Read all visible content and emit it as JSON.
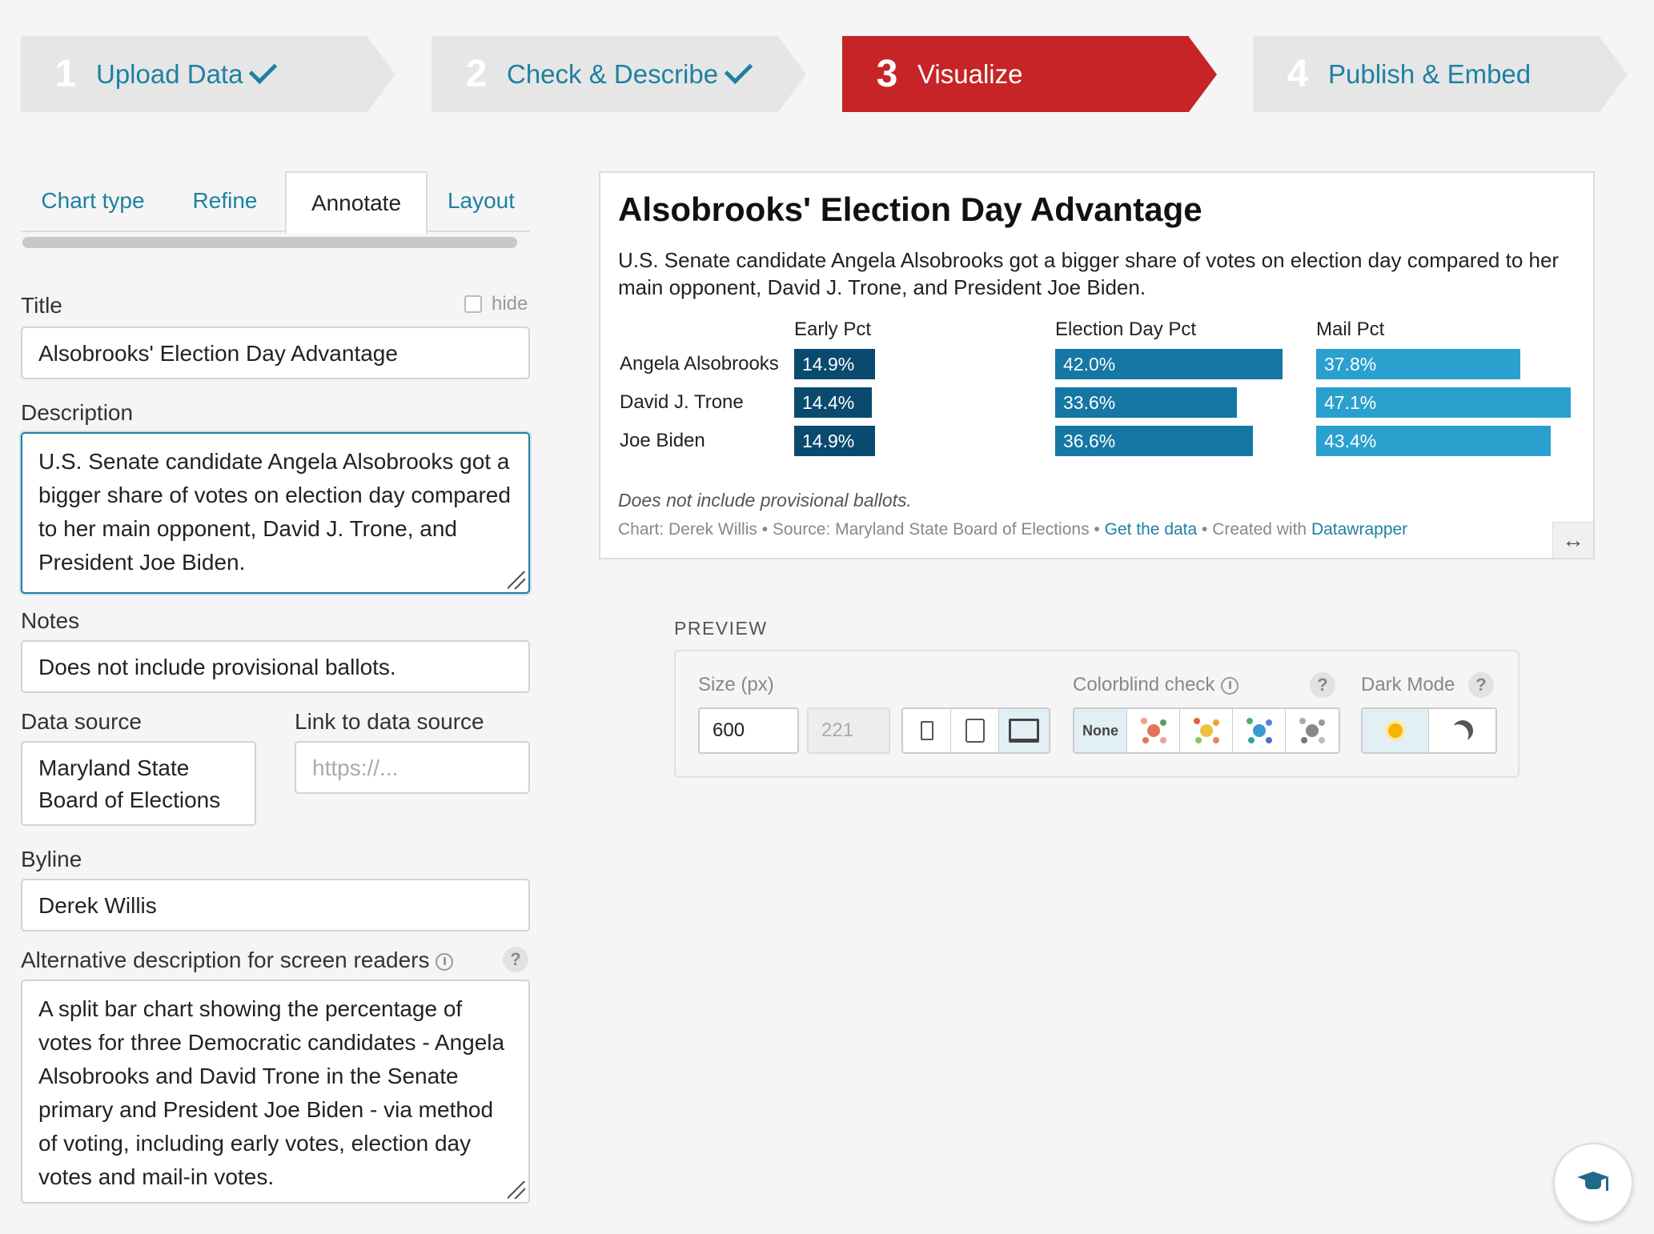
{
  "steps": [
    {
      "num": "1",
      "label": "Upload Data",
      "done": true,
      "active": false
    },
    {
      "num": "2",
      "label": "Check & Describe",
      "done": true,
      "active": false
    },
    {
      "num": "3",
      "label": "Visualize",
      "done": false,
      "active": true
    },
    {
      "num": "4",
      "label": "Publish & Embed",
      "done": false,
      "active": false
    }
  ],
  "tabs": [
    "Chart type",
    "Refine",
    "Annotate",
    "Layout"
  ],
  "active_tab": "Annotate",
  "form": {
    "title_label": "Title",
    "hide_label": "hide",
    "title_value": "Alsobrooks' Election Day Advantage",
    "description_label": "Description",
    "description_value": "U.S. Senate candidate Angela Alsobrooks got a bigger share of votes on election day compared to her main opponent, David J. Trone, and President Joe Biden.",
    "notes_label": "Notes",
    "notes_value": "Does not include provisional ballots.",
    "source_label": "Data source",
    "source_value": "Maryland State Board of Elections",
    "link_label": "Link to data source",
    "link_placeholder": "https://...",
    "byline_label": "Byline",
    "byline_value": "Derek Willis",
    "alt_label": "Alternative description for screen readers",
    "alt_value": "A split bar chart showing the percentage of votes for three Democratic candidates - Angela Alsobrooks and David Trone in the Senate primary and President Joe Biden - via method of voting, including early votes, election day votes and mail-in votes."
  },
  "chart": {
    "title": "Alsobrooks' Election Day Advantage",
    "description": "U.S. Senate candidate Angela Alsobrooks got a bigger share of votes on election day compared to her main opponent, David J. Trone, and President Joe Biden.",
    "notes": "Does not include provisional ballots.",
    "footer_prefix": "Chart: Derek Willis • Source: Maryland State Board of Elections • ",
    "get_data": "Get the data",
    "created_with": " • Created with ",
    "datawrapper": "Datawrapper",
    "expand_icon": "↔"
  },
  "chart_data": {
    "type": "bar",
    "categories": [
      "Angela Alsobrooks",
      "David J. Trone",
      "Joe Biden"
    ],
    "series": [
      {
        "name": "Early Pct",
        "values": [
          14.9,
          14.4,
          14.9
        ],
        "labels": [
          "14.9%",
          "14.4%",
          "14.9%"
        ],
        "color": "#0b4a6f"
      },
      {
        "name": "Election Day Pct",
        "values": [
          42.0,
          33.6,
          36.6
        ],
        "labels": [
          "42.0%",
          "33.6%",
          "36.6%"
        ],
        "color": "#1577a3"
      },
      {
        "name": "Mail Pct",
        "values": [
          37.8,
          47.1,
          43.4
        ],
        "labels": [
          "37.8%",
          "47.1%",
          "43.4%"
        ],
        "color": "#2aa0cf"
      }
    ],
    "title": "Alsobrooks' Election Day Advantage",
    "xlabel": "",
    "ylabel": ""
  },
  "preview": {
    "heading": "PREVIEW",
    "size_label": "Size (px)",
    "width": "600",
    "height": "221",
    "colorblind_label": "Colorblind check",
    "none_label": "None",
    "darkmode_label": "Dark Mode",
    "help": "?"
  },
  "colors": {
    "accent": "#1d81a2",
    "active_step": "#c62426"
  }
}
